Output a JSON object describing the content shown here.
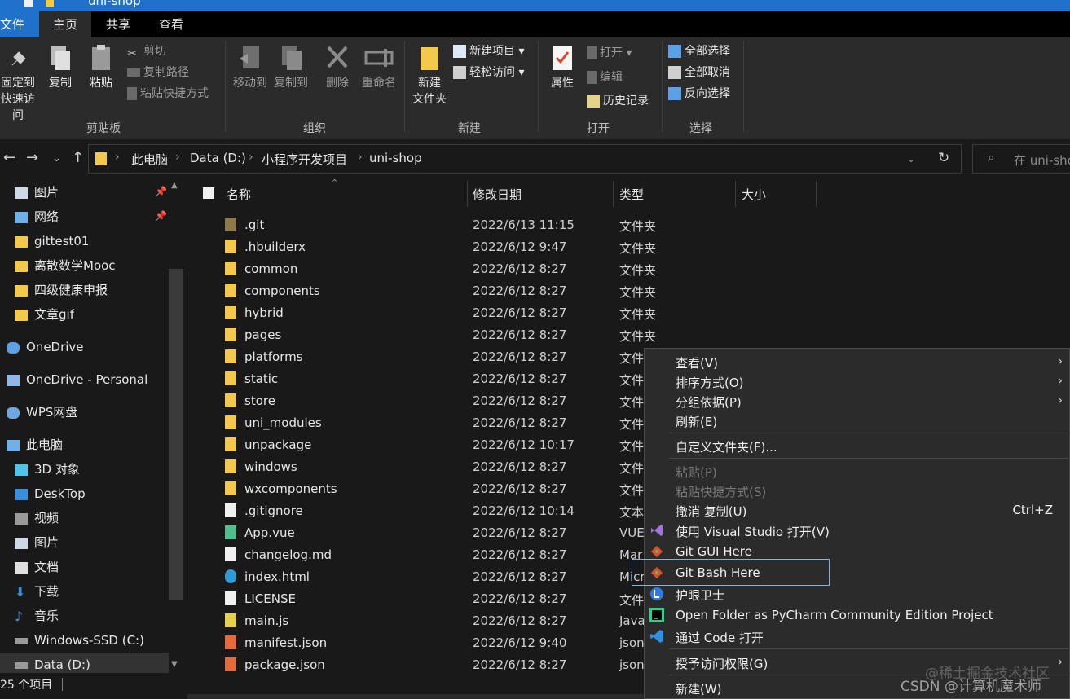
{
  "window": {
    "title": "uni-shop"
  },
  "ribbon": {
    "tabs": [
      "文件",
      "主页",
      "共享",
      "查看"
    ],
    "clipboard": {
      "pin_label_1": "固定到",
      "pin_label_2": "快速访问",
      "copy": "复制",
      "paste": "粘贴",
      "cut": "剪切",
      "copy_path": "复制路径",
      "paste_shortcut": "粘贴快捷方式",
      "group": "剪贴板"
    },
    "organize": {
      "move_to": "移动到",
      "copy_to": "复制到",
      "delete": "删除",
      "rename": "重命名",
      "group": "组织"
    },
    "new": {
      "new_folder_1": "新建",
      "new_folder_2": "文件夹",
      "new_item": "新建项目",
      "easy_access": "轻松访问",
      "group": "新建"
    },
    "open": {
      "properties": "属性",
      "open": "打开",
      "edit": "编辑",
      "history": "历史记录",
      "group": "打开"
    },
    "select": {
      "select_all": "全部选择",
      "select_none": "全部取消",
      "invert": "反向选择",
      "group": "选择"
    }
  },
  "address": {
    "crumbs": [
      "此电脑",
      "Data (D:)",
      "小程序开发项目",
      "uni-shop"
    ],
    "search_placeholder": "在 uni-shop"
  },
  "nav": {
    "items": [
      {
        "label": "图片",
        "pinned": true
      },
      {
        "label": "网络",
        "pinned": true
      },
      {
        "label": "gittest01"
      },
      {
        "label": "离散数学Mooc"
      },
      {
        "label": "四级健康申报"
      },
      {
        "label": "文章gif"
      },
      {
        "label": "OneDrive"
      },
      {
        "label": "OneDrive - Personal"
      },
      {
        "label": "WPS网盘"
      },
      {
        "label": "此电脑"
      },
      {
        "label": "3D 对象"
      },
      {
        "label": "DeskTop"
      },
      {
        "label": "视频"
      },
      {
        "label": "图片"
      },
      {
        "label": "文档"
      },
      {
        "label": "下载"
      },
      {
        "label": "音乐"
      },
      {
        "label": "Windows-SSD (C:)"
      },
      {
        "label": "Data (D:)"
      }
    ]
  },
  "list": {
    "columns": [
      "名称",
      "修改日期",
      "类型",
      "大小"
    ],
    "rows": [
      {
        "name": ".git",
        "date": "2022/6/13 11:15",
        "type": "文件夹",
        "icon": "folder-icon"
      },
      {
        "name": ".hbuilderx",
        "date": "2022/6/12 9:47",
        "type": "文件夹",
        "icon": "folder-icon"
      },
      {
        "name": "common",
        "date": "2022/6/12 8:27",
        "type": "文件夹",
        "icon": "folder-icon"
      },
      {
        "name": "components",
        "date": "2022/6/12 8:27",
        "type": "文件夹",
        "icon": "folder-icon"
      },
      {
        "name": "hybrid",
        "date": "2022/6/12 8:27",
        "type": "文件夹",
        "icon": "folder-icon"
      },
      {
        "name": "pages",
        "date": "2022/6/12 8:27",
        "type": "文件夹",
        "icon": "folder-icon"
      },
      {
        "name": "platforms",
        "date": "2022/6/12 8:27",
        "type": "文件",
        "icon": "folder-icon"
      },
      {
        "name": "static",
        "date": "2022/6/12 8:27",
        "type": "文件",
        "icon": "folder-icon"
      },
      {
        "name": "store",
        "date": "2022/6/12 8:27",
        "type": "文件",
        "icon": "folder-icon"
      },
      {
        "name": "uni_modules",
        "date": "2022/6/12 8:27",
        "type": "文件",
        "icon": "folder-icon"
      },
      {
        "name": "unpackage",
        "date": "2022/6/12 10:17",
        "type": "文件",
        "icon": "folder-icon"
      },
      {
        "name": "windows",
        "date": "2022/6/12 8:27",
        "type": "文件",
        "icon": "folder-icon"
      },
      {
        "name": "wxcomponents",
        "date": "2022/6/12 8:27",
        "type": "文件",
        "icon": "folder-icon"
      },
      {
        "name": ".gitignore",
        "date": "2022/6/12 10:14",
        "type": "文本",
        "icon": "file-icon"
      },
      {
        "name": "App.vue",
        "date": "2022/6/12 8:27",
        "type": "VUE",
        "icon": "vue-file-icon"
      },
      {
        "name": "changelog.md",
        "date": "2022/6/12 8:27",
        "type": "Mar",
        "icon": "markdown-file-icon"
      },
      {
        "name": "index.html",
        "date": "2022/6/12 8:27",
        "type": "Micr",
        "icon": "edge-file-icon"
      },
      {
        "name": "LICENSE",
        "date": "2022/6/12 8:27",
        "type": "文件",
        "icon": "file-icon"
      },
      {
        "name": "main.js",
        "date": "2022/6/12 8:27",
        "type": "Java",
        "icon": "js-file-icon"
      },
      {
        "name": "manifest.json",
        "date": "2022/6/12 9:40",
        "type": "json",
        "icon": "json-file-icon"
      },
      {
        "name": "package.json",
        "date": "2022/6/12 8:27",
        "type": "json",
        "icon": "json-file-icon"
      }
    ]
  },
  "status": {
    "count": "25 个项目"
  },
  "context_menu": {
    "items": [
      {
        "label": "查看(V)",
        "submenu": true
      },
      {
        "label": "排序方式(O)",
        "submenu": true
      },
      {
        "label": "分组依据(P)",
        "submenu": true
      },
      {
        "label": "刷新(E)"
      },
      {
        "label": "自定义文件夹(F)..."
      },
      {
        "label": "粘贴(P)",
        "disabled": true
      },
      {
        "label": "粘贴快捷方式(S)",
        "disabled": true
      },
      {
        "label": "撤消 复制(U)",
        "shortcut": "Ctrl+Z"
      },
      {
        "label": "使用 Visual Studio 打开(V)",
        "icon": "visual-studio-icon"
      },
      {
        "label": "Git GUI Here",
        "icon": "git-icon"
      },
      {
        "label": "Git Bash Here",
        "icon": "git-icon"
      },
      {
        "label": "护眼卫士",
        "icon": "eye-guard-icon"
      },
      {
        "label": "Open Folder as PyCharm Community Edition Project",
        "icon": "pycharm-icon"
      },
      {
        "label": "通过 Code 打开",
        "icon": "vscode-icon"
      },
      {
        "label": "授予访问权限(G)",
        "submenu": true
      },
      {
        "label": "新建(W)"
      }
    ]
  },
  "watermark": {
    "line1": "@稀土掘金技术社区",
    "line2": "CSDN @计算机魔术师"
  }
}
